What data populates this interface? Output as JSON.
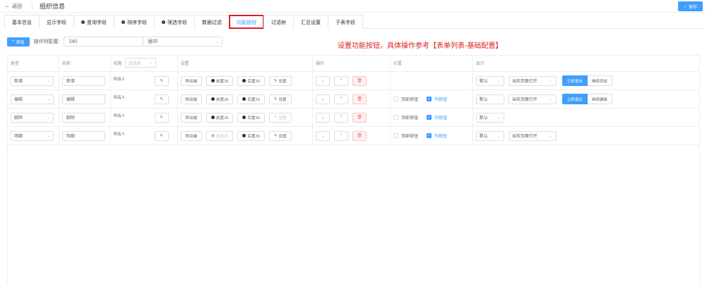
{
  "header": {
    "back_label": "返回",
    "title": "组织信息",
    "save_label": "保存"
  },
  "tabs": [
    {
      "label": "基本信息",
      "info": false
    },
    {
      "label": "显示字段",
      "info": false
    },
    {
      "label": "查询字段",
      "info": true
    },
    {
      "label": "排序字段",
      "info": true
    },
    {
      "label": "筛选字段",
      "info": true
    },
    {
      "label": "数据过滤",
      "info": false
    },
    {
      "label": "功能按钮",
      "info": false,
      "active": true
    },
    {
      "label": "过滤树",
      "info": false
    },
    {
      "label": "汇总设置",
      "info": false
    },
    {
      "label": "子表字段",
      "info": false
    }
  ],
  "toolbar": {
    "add_label": "添加",
    "width_label": "操作列配置:",
    "width_value": "240",
    "align_value": "居中"
  },
  "hint": "设置功能按钮，具体操作参考【表单列表-基础配置】",
  "columns": {
    "type": "类型",
    "name": "名称",
    "perm": "权限",
    "perm_placeholder": "请选择",
    "settings": "设置",
    "ops": "操作",
    "position": "位置",
    "display": "显示"
  },
  "labels": {
    "move_end": "移动端",
    "front_js": "前置JS",
    "back_js": "后置JS",
    "setting": "设置",
    "top_btn": "顶部按钮",
    "col_btn": "列按钮"
  },
  "rows": [
    {
      "type": "新增",
      "name": "新增",
      "perm": "所有人",
      "show_position": false,
      "top_checked": false,
      "col_checked": false,
      "display": "默认",
      "open": "当前页面打开",
      "seg": [
        "立即退出",
        "继续添加"
      ],
      "front_disabled": false,
      "back_disabled": false,
      "set_disabled": false
    },
    {
      "type": "编辑",
      "name": "编辑",
      "perm": "所有人",
      "show_position": true,
      "top_checked": false,
      "col_checked": true,
      "display": "默认",
      "open": "当前页面打开",
      "seg": [
        "立即退出",
        "继续编辑"
      ],
      "front_disabled": false,
      "back_disabled": false,
      "set_disabled": false
    },
    {
      "type": "删除",
      "name": "删除",
      "perm": "所有人",
      "show_position": true,
      "top_checked": false,
      "col_checked": true,
      "display": "默认",
      "open": "",
      "seg": [],
      "front_disabled": false,
      "back_disabled": false,
      "set_disabled": true
    },
    {
      "type": "明细",
      "name": "明细",
      "perm": "所有人",
      "show_position": true,
      "top_checked": false,
      "col_checked": true,
      "display": "默认",
      "open": "当前页面打开",
      "seg": [],
      "front_disabled": true,
      "back_disabled": false,
      "set_disabled": false
    }
  ]
}
